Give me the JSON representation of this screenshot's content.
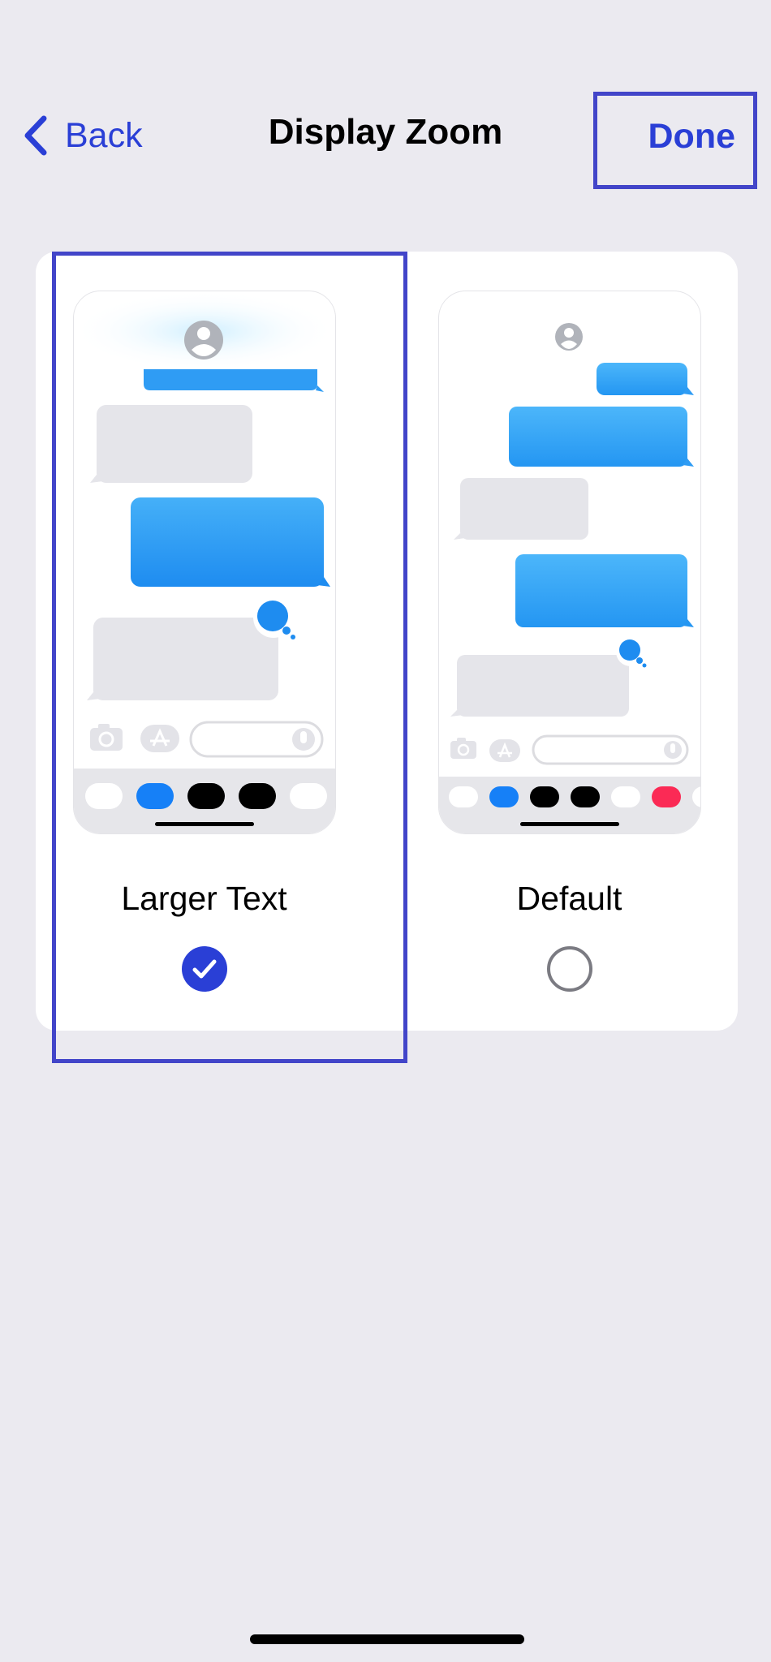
{
  "navbar": {
    "back_label": "Back",
    "title": "Display Zoom",
    "done_label": "Done"
  },
  "options": [
    {
      "label": "Larger Text",
      "selected": true
    },
    {
      "label": "Default",
      "selected": false
    }
  ],
  "colors": {
    "accent": "#2a3fd6",
    "annotation_box": "#4245c9",
    "background": "#ebeaf0",
    "bubble_blue": "#2196f3",
    "bubble_gray": "#e5e5ea"
  }
}
